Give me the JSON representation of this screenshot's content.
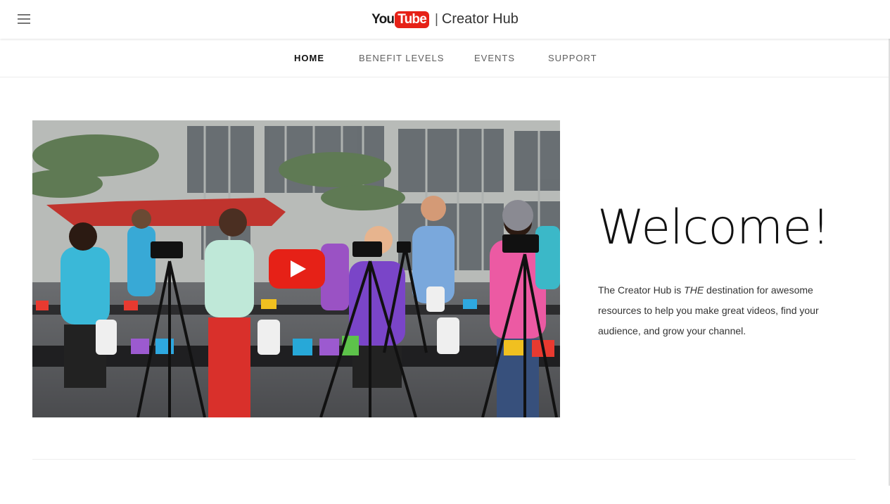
{
  "header": {
    "menu_icon": "hamburger-menu-icon",
    "logo_you": "You",
    "logo_tube": "Tube",
    "separator": "|",
    "title": "Creator Hub",
    "logo_color": "#e62117"
  },
  "nav": {
    "items": [
      {
        "label": "HOME",
        "active": true
      },
      {
        "label": "BENEFIT LEVELS",
        "active": false
      },
      {
        "label": "EVENTS",
        "active": false
      },
      {
        "label": "SUPPORT",
        "active": false
      }
    ]
  },
  "hero": {
    "video_icon": "play-button-icon",
    "heading": "Welcome!",
    "intro_before": "The Creator Hub is ",
    "intro_emphasis": "THE",
    "intro_after": " destination for awesome resources to help you make great videos, find your audience, and grow your channel."
  }
}
